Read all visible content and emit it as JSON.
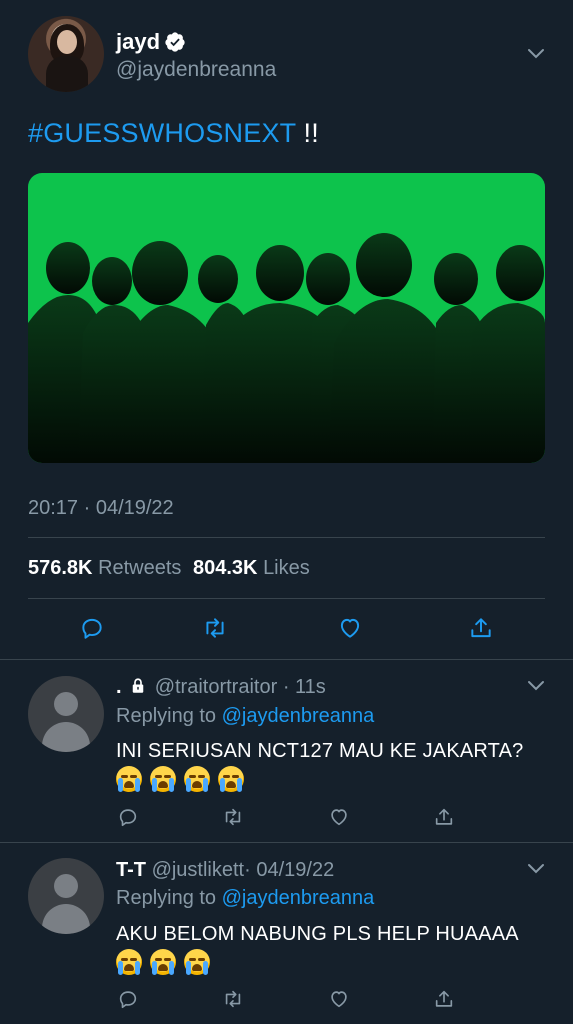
{
  "tweet": {
    "display_name": "jayd",
    "handle": "@jaydenbreanna",
    "hashtag": "#GUESSWHOSNEXT",
    "text_suffix": " !!",
    "timestamp": "20:17 · 04/19/22",
    "retweets_count": "576.8K",
    "retweets_label": "Retweets",
    "likes_count": "804.3K",
    "likes_label": "Likes"
  },
  "replies": [
    {
      "display_name": ".",
      "handle": "@traitortraitor",
      "time": "· 11s",
      "replying_label": "Replying to",
      "replying_to": "@jaydenbreanna",
      "text": "INI SERIUSAN NCT127 MAU KE JAKARTA?",
      "emoji_count": 4
    },
    {
      "display_name": "T-T",
      "handle": "@justlikett",
      "time": "· 04/19/22",
      "replying_label": "Replying to",
      "replying_to": "@jaydenbreanna",
      "text": "AKU BELOM NABUNG PLS HELP HUAAAA",
      "emoji_count": 3
    }
  ],
  "icons": {
    "verified": "verified-badge-icon",
    "lock": "lock-icon",
    "reply": "reply-icon",
    "retweet": "retweet-icon",
    "like": "heart-icon",
    "share": "share-icon",
    "menu": "chevron-down-icon"
  },
  "colors": {
    "background": "#15202b",
    "link": "#1d9bf0",
    "muted": "#8899a6",
    "media_green": "#0dc34c"
  }
}
